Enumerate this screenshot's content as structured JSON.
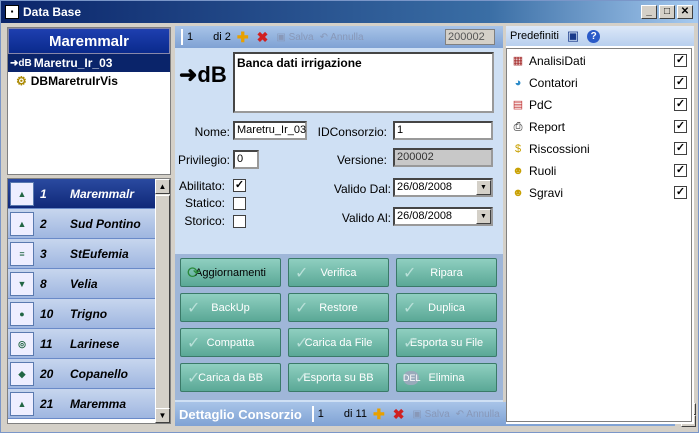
{
  "window": {
    "title": "Data Base"
  },
  "left_tree": {
    "header": "Maremmalr",
    "items": [
      {
        "label": "Maretru_Ir_03",
        "icon": "db-icon",
        "selected": true
      },
      {
        "label": "DBMaretruIrVis",
        "icon": "gears-icon",
        "selected": false
      }
    ]
  },
  "consorzi": [
    {
      "num": "1",
      "name": "Maremmalr",
      "selected": true
    },
    {
      "num": "2",
      "name": "Sud Pontino",
      "selected": false
    },
    {
      "num": "3",
      "name": "StEufemia",
      "selected": false
    },
    {
      "num": "8",
      "name": "Velia",
      "selected": false
    },
    {
      "num": "10",
      "name": "Trigno",
      "selected": false
    },
    {
      "num": "11",
      "name": "Larinese",
      "selected": false
    },
    {
      "num": "20",
      "name": "Copanello",
      "selected": false
    },
    {
      "num": "21",
      "name": "Maremma",
      "selected": false
    }
  ],
  "topnav": {
    "record": "1",
    "of": "di 2",
    "save": "Salva",
    "cancel": "Annulla",
    "id": "200002"
  },
  "form": {
    "icon_text": "➜dB",
    "description": "Banca dati irrigazione",
    "nome_label": "Nome:",
    "nome_value": "Maretru_Ir_03",
    "idconsorzio_label": "IDConsorzio:",
    "idconsorzio_value": "1",
    "privilegio_label": "Privilegio:",
    "privilegio_value": "0",
    "versione_label": "Versione:",
    "versione_value": "200002",
    "abilitato_label": "Abilitato:",
    "statico_label": "Statico:",
    "storico_label": "Storico:",
    "valido_dal_label": "Valido Dal:",
    "valido_dal_value": "26/08/2008",
    "valido_al_label": "Valido Al:",
    "valido_al_value": "26/08/2008",
    "abilitato": true,
    "statico": false,
    "storico": false
  },
  "actions": [
    {
      "label": "Aggiornamenti",
      "enabled": true
    },
    {
      "label": "Verifica",
      "enabled": false
    },
    {
      "label": "Ripara",
      "enabled": false
    },
    {
      "label": "BackUp",
      "enabled": false
    },
    {
      "label": "Restore",
      "enabled": false
    },
    {
      "label": "Duplica",
      "enabled": false
    },
    {
      "label": "Compatta",
      "enabled": false
    },
    {
      "label": "Carica da File",
      "enabled": false
    },
    {
      "label": "Esporta su File",
      "enabled": false
    },
    {
      "label": "Carica da BB",
      "enabled": false
    },
    {
      "label": "Esporta su BB",
      "enabled": false
    },
    {
      "label": "Elimina",
      "enabled": false
    }
  ],
  "bottombar": {
    "title": "Dettaglio Consorzio",
    "record": "1",
    "of": "di 11",
    "save": "Salva",
    "cancel": "Annulla"
  },
  "predefiniti": {
    "header": "Predefiniti",
    "items": [
      {
        "label": "AnalisiDati",
        "checked": true
      },
      {
        "label": "Contatori",
        "checked": true
      },
      {
        "label": "PdC",
        "checked": true
      },
      {
        "label": "Report",
        "checked": true
      },
      {
        "label": "Riscossioni",
        "checked": true
      },
      {
        "label": "Ruoli",
        "checked": true
      },
      {
        "label": "Sgravi",
        "checked": true
      }
    ]
  }
}
